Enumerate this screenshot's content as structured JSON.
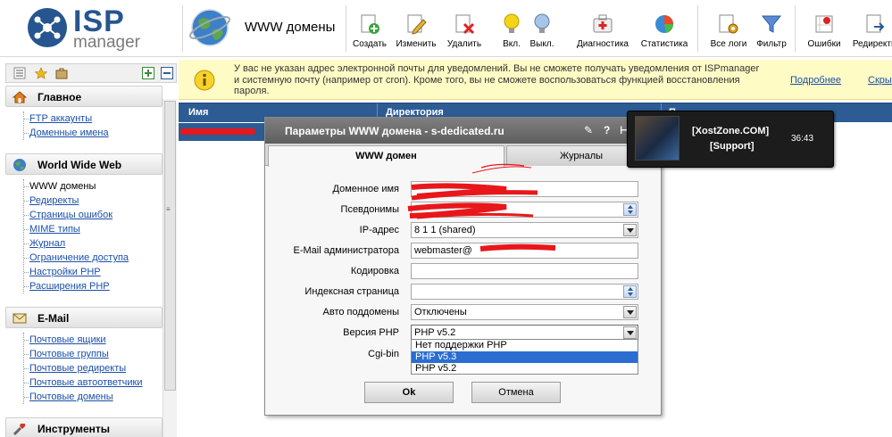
{
  "logo": {
    "brand": "ISP",
    "product": "manager"
  },
  "page_title": "WWW домены",
  "toolbar": [
    {
      "id": "create",
      "label": "Создать",
      "icon": "create-icon"
    },
    {
      "id": "edit",
      "label": "Изменить",
      "icon": "edit-icon"
    },
    {
      "id": "delete",
      "label": "Удалить",
      "icon": "delete-icon"
    },
    {
      "id": "enable",
      "label": "Вкл.",
      "icon": "bulb-on-icon"
    },
    {
      "id": "disable",
      "label": "Выкл.",
      "icon": "bulb-off-icon"
    },
    {
      "id": "diagnostics",
      "label": "Диагностика",
      "icon": "first-aid-icon"
    },
    {
      "id": "stats",
      "label": "Статистика",
      "icon": "pie-chart-icon"
    },
    {
      "id": "logs",
      "label": "Все логи",
      "icon": "logs-gear-icon"
    },
    {
      "id": "filter",
      "label": "Фильтр",
      "icon": "filter-icon"
    },
    {
      "id": "errors",
      "label": "Ошибки",
      "icon": "errors-icon"
    },
    {
      "id": "redirect",
      "label": "Редиректы",
      "icon": "redirect-icon"
    }
  ],
  "sidebar": {
    "groups": [
      {
        "title": "Главное",
        "icon": "home-icon",
        "items": [
          "FTP аккаунты",
          "Доменные имена"
        ]
      },
      {
        "title": "World Wide Web",
        "icon": "globe-icon",
        "items": [
          "WWW домены",
          "Редиректы",
          "Страницы ошибок",
          "MIME типы",
          "Журнал",
          "Ограничение доступа",
          "Настройки PHP",
          "Расширения PHP"
        ],
        "current": 0
      },
      {
        "title": "E-Mail",
        "icon": "mail-icon",
        "items": [
          "Почтовые ящики",
          "Почтовые группы",
          "Почтовые редиректы",
          "Почтовые автоответчики",
          "Почтовые домены"
        ]
      },
      {
        "title": "Инструменты",
        "icon": "tools-icon",
        "items": []
      }
    ]
  },
  "notice": {
    "text": "У вас не указан адрес электронной почты для уведомлений. Вы не сможете получать уведомления от ISPmanager и системную почту (например от cron). Кроме того, вы не сможете воспользоваться функцией восстановления пароля.",
    "more_link": "Подробнее",
    "hide_link": "Скры"
  },
  "grid": {
    "col_name": "Имя",
    "col_dir": "Директория",
    "col_extra": "П"
  },
  "dialog": {
    "title": "Параметры WWW домена - s-dedicated.ru",
    "tabs": [
      "WWW домен",
      "Журналы"
    ],
    "fields": {
      "domain_label": "Доменное имя",
      "aliases_label": "Псевдонимы",
      "ip_label": "IP-адрес",
      "ip_value": "8  1  1  (shared)",
      "email_label": "E-Mail администратора",
      "email_value": "webmaster@",
      "charset_label": "Кодировка",
      "index_label": "Индексная страница",
      "autosub_label": "Авто поддомены",
      "autosub_value": "Отключены",
      "php_label": "Версия PHP",
      "php_value": "PHP v5.2",
      "cgi_label": "Cgi-bin"
    },
    "php_options": [
      "Нет поддержки PHP",
      "PHP v5.3",
      "PHP v5.2"
    ],
    "php_highlight": 1,
    "ok_label": "Ok",
    "cancel_label": "Отмена"
  },
  "popup": {
    "name_line1": "[XostZone.COM]",
    "name_line2": "[Support]",
    "time": "36:43"
  }
}
